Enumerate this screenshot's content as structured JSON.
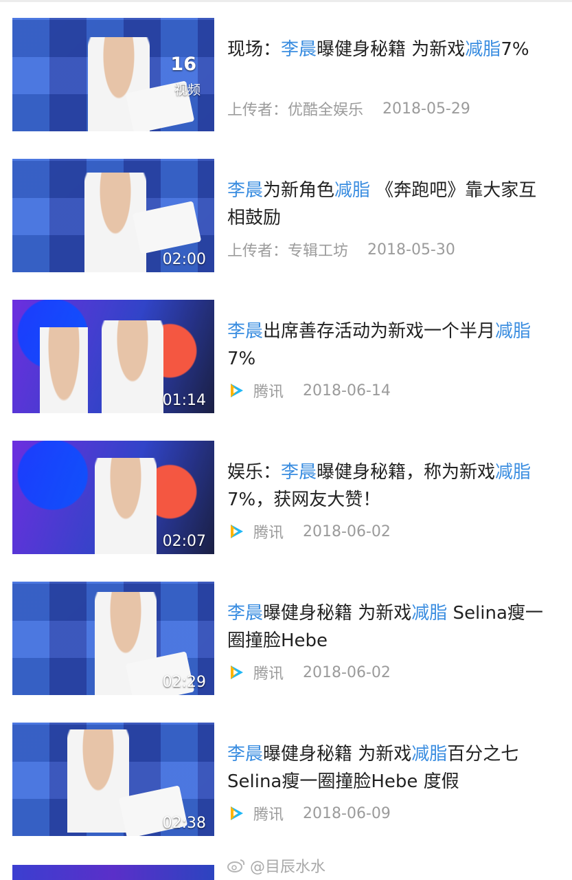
{
  "videos": [
    {
      "title_parts": [
        {
          "text": "现场：",
          "hl": false
        },
        {
          "text": "李晨",
          "hl": true
        },
        {
          "text": "曝健身秘籍 为新戏",
          "hl": false
        },
        {
          "text": "减脂",
          "hl": true
        },
        {
          "text": "7%",
          "hl": false
        }
      ],
      "badge_count": "16",
      "badge_label": "视频",
      "uploader_label": "上传者：优酷全娱乐",
      "date": "2018-05-29"
    },
    {
      "title_parts": [
        {
          "text": "李晨",
          "hl": true
        },
        {
          "text": "为新角色",
          "hl": false
        },
        {
          "text": "减脂",
          "hl": true
        },
        {
          "text": " 《奔跑吧》靠大家互相鼓励",
          "hl": false
        }
      ],
      "duration": "02:00",
      "uploader_label": "上传者：专辑工坊",
      "date": "2018-05-30"
    },
    {
      "title_parts": [
        {
          "text": "李晨",
          "hl": true
        },
        {
          "text": "出席善存活动为新戏一个半月",
          "hl": false
        },
        {
          "text": "减脂",
          "hl": true
        },
        {
          "text": "7%",
          "hl": false
        }
      ],
      "duration": "01:14",
      "source": "腾讯",
      "source_icon": "tencent-video-icon",
      "date": "2018-06-14"
    },
    {
      "title_parts": [
        {
          "text": "娱乐：",
          "hl": false
        },
        {
          "text": "李晨",
          "hl": true
        },
        {
          "text": "曝健身秘籍，称为新戏",
          "hl": false
        },
        {
          "text": "减脂",
          "hl": true
        },
        {
          "text": "7%，获网友大赞！",
          "hl": false
        }
      ],
      "duration": "02:07",
      "source": "腾讯",
      "source_icon": "tencent-video-icon",
      "date": "2018-06-02"
    },
    {
      "title_parts": [
        {
          "text": "李晨",
          "hl": true
        },
        {
          "text": "曝健身秘籍 为新戏",
          "hl": false
        },
        {
          "text": "减脂",
          "hl": true
        },
        {
          "text": " Selina瘦一圈撞脸Hebe",
          "hl": false
        }
      ],
      "duration": "02:29",
      "source": "腾讯",
      "source_icon": "tencent-video-icon",
      "date": "2018-06-02"
    },
    {
      "title_parts": [
        {
          "text": "李晨",
          "hl": true
        },
        {
          "text": "曝健身秘籍 为新戏",
          "hl": false
        },
        {
          "text": "减脂",
          "hl": true
        },
        {
          "text": "百分之七Selina瘦一圈撞脸Hebe 度假",
          "hl": false
        }
      ],
      "duration": "02:38",
      "source": "腾讯",
      "source_icon": "tencent-video-icon",
      "date": "2018-06-09"
    }
  ],
  "watermark": "@目辰水水",
  "colors": {
    "highlight": "#3a8de0",
    "meta": "#9b9b9b",
    "title": "#222222"
  }
}
